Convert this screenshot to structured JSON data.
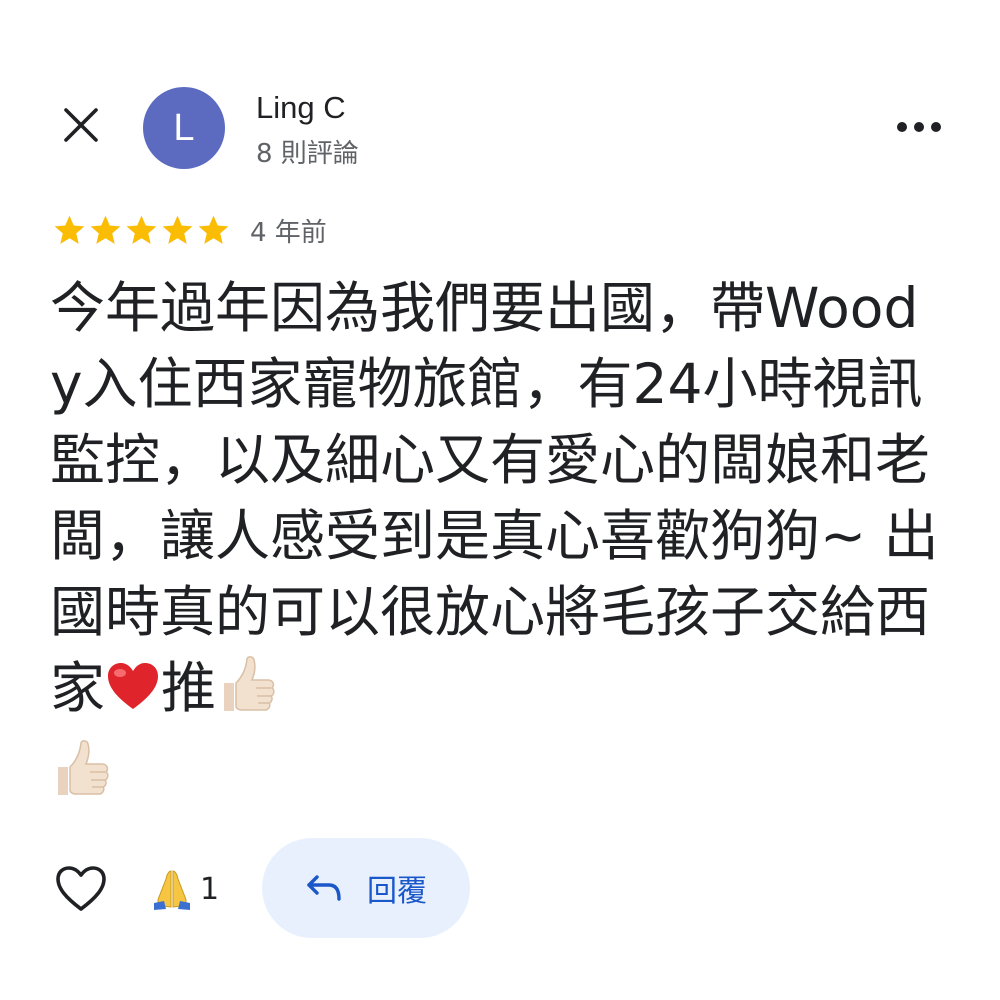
{
  "header": {
    "user_name": "Ling C",
    "review_count_label": "8 則評論",
    "avatar_initial": "L",
    "avatar_color": "#5c6bc0"
  },
  "rating": {
    "stars": 5,
    "max_stars": 5,
    "star_color": "#fbbc04",
    "age_label": "4 年前"
  },
  "review": {
    "text_part1": "今年過年因為我們要出國，帶Woody入住西家寵物旅館，有24小時視訊監控，以及細心又有愛心的闆娘和老闆，讓人感受到是真心喜歡狗狗~ 出國時真的可以很放心將毛孩子交給西家",
    "text_part2": "推",
    "emoji_1": "heart-emoji",
    "emoji_2": "thumbs-up-emoji",
    "emoji_3": "thumbs-up-emoji"
  },
  "actions": {
    "like_icon": "heart-outline-icon",
    "reaction_icon": "folded-hands-emoji",
    "reaction_count": "1",
    "reply_label": "回覆",
    "reply_icon": "reply-arrow-icon",
    "accent_color": "#1a57c9"
  },
  "icons": {
    "close": "close-icon",
    "more": "more-horizontal-icon"
  }
}
